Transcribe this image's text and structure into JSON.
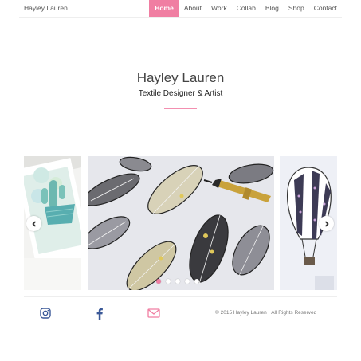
{
  "header": {
    "brand": "Hayley Lauren",
    "nav": [
      {
        "label": "Home",
        "active": true
      },
      {
        "label": "About"
      },
      {
        "label": "Work"
      },
      {
        "label": "Collab"
      },
      {
        "label": "Blog"
      },
      {
        "label": "Shop"
      },
      {
        "label": "Contact"
      }
    ]
  },
  "hero": {
    "title": "Hayley Lauren",
    "subtitle": "Textile Designer & Artist"
  },
  "carousel": {
    "slides": [
      {
        "icon": "cactus-artwork-image"
      },
      {
        "icon": "leaf-drawing-image"
      },
      {
        "icon": "hot-air-balloon-artwork-image"
      }
    ],
    "prev_icon": "chevron-left-icon",
    "next_icon": "chevron-right-icon",
    "active_slide": 1,
    "dot_count": 5
  },
  "footer": {
    "social": [
      {
        "icon": "instagram-icon",
        "color": "#3b5998"
      },
      {
        "icon": "facebook-icon",
        "color": "#3b5998"
      },
      {
        "icon": "email-icon",
        "color": "#f07ea2"
      }
    ],
    "copyright": "© 2015 Hayley Lauren · All Rights Reserved"
  },
  "colors": {
    "accent": "#f07ea2",
    "social_blue": "#3b5998"
  }
}
